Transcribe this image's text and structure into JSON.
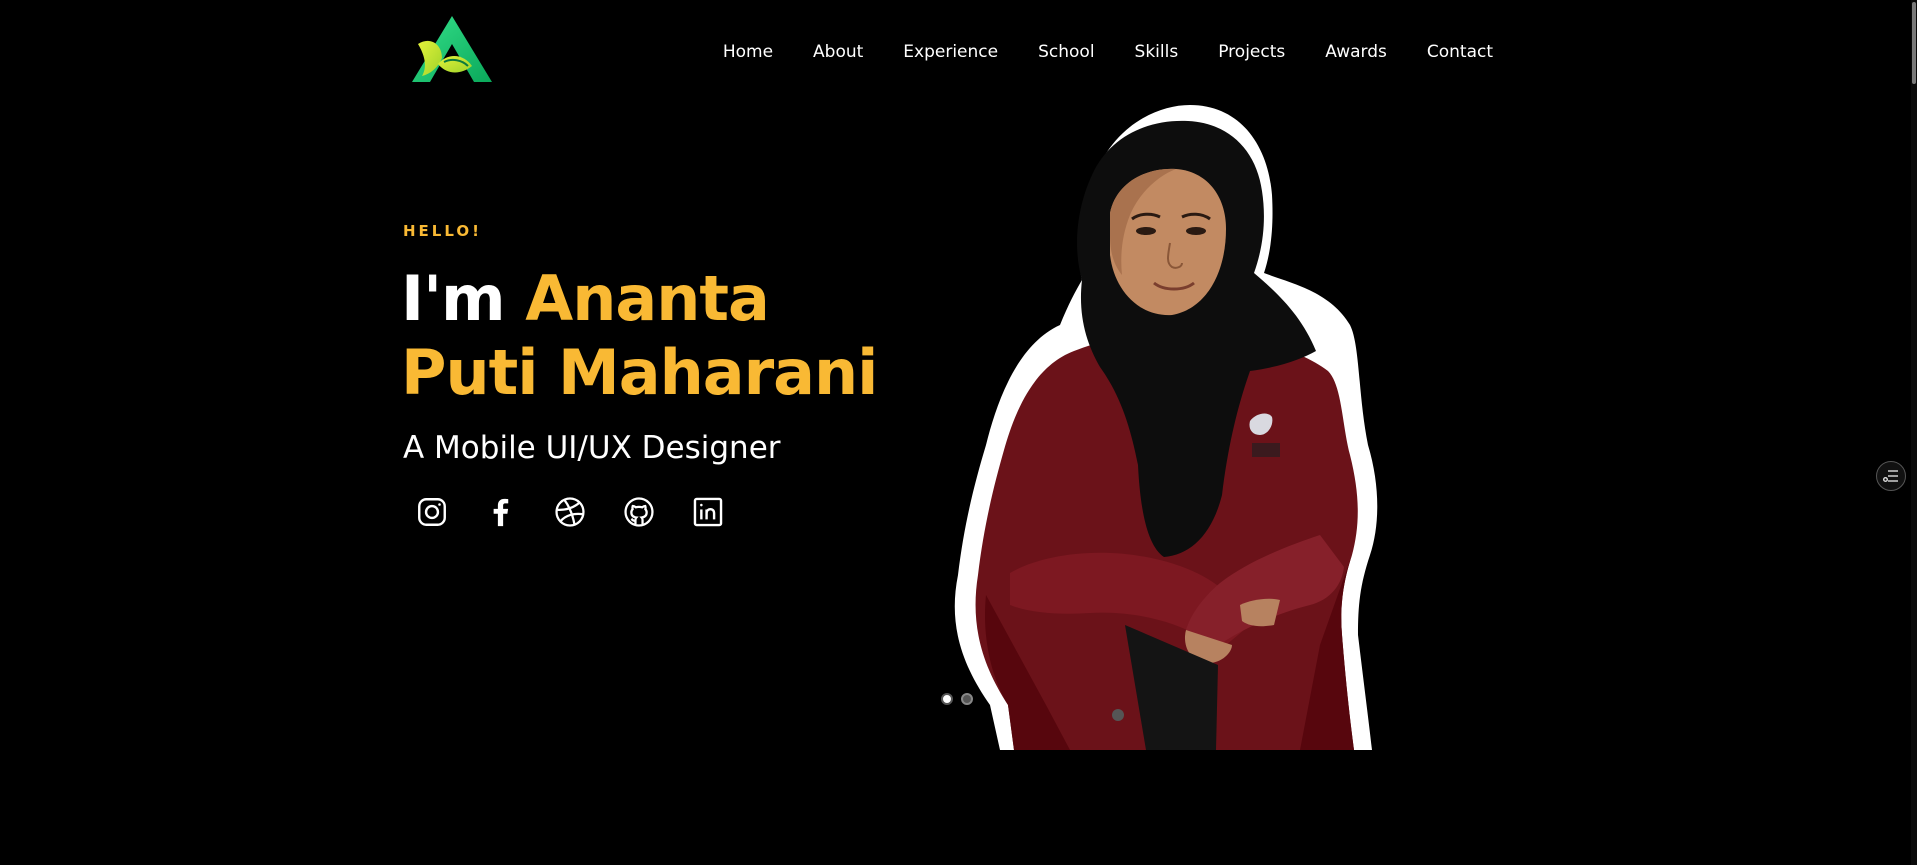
{
  "brand": {
    "logo_icon": "leaf-a-logo-icon",
    "colors": [
      "#1ec879",
      "#c6e63a"
    ]
  },
  "nav": {
    "items": [
      {
        "label": "Home"
      },
      {
        "label": "About"
      },
      {
        "label": "Experience"
      },
      {
        "label": "School"
      },
      {
        "label": "Skills"
      },
      {
        "label": "Projects"
      },
      {
        "label": "Awards"
      },
      {
        "label": "Contact"
      }
    ]
  },
  "hero": {
    "greeting": "HELLO!",
    "intro": "I'm",
    "name": "Ananta Puti Maharani",
    "role": "A Mobile UI/UX Designer",
    "accent_color": "#f9b934"
  },
  "socials": [
    {
      "icon": "instagram-icon"
    },
    {
      "icon": "facebook-icon"
    },
    {
      "icon": "dribbble-icon"
    },
    {
      "icon": "github-icon"
    },
    {
      "icon": "linkedin-icon"
    }
  ],
  "carousel": {
    "slides": 2,
    "active_index": 0
  },
  "side_button": {
    "icon": "settings-sliders-icon"
  }
}
